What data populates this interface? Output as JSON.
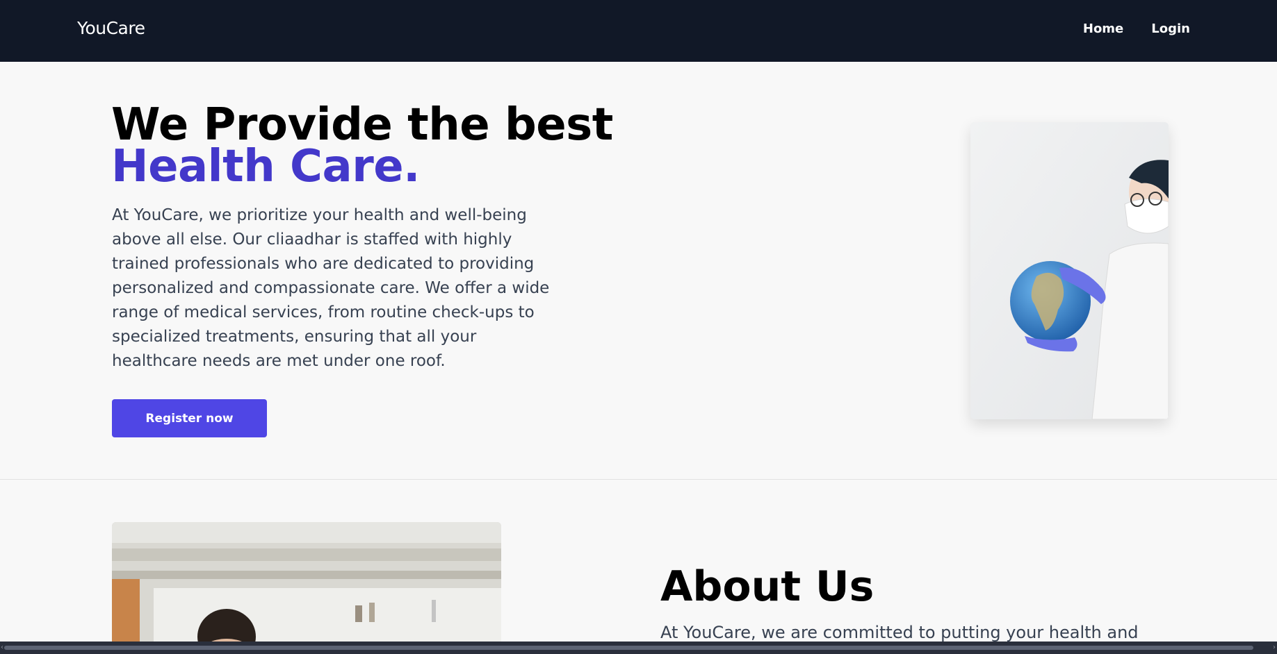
{
  "navbar": {
    "brand": "YouCare",
    "links": [
      "Home",
      "Login"
    ]
  },
  "hero": {
    "title_line1": "We Provide the best",
    "title_line2": "Health Care.",
    "description": "At YouCare, we prioritize your health and well-being above all else. Our cliaadhar is staffed with highly trained professionals who are dedicated to providing personalized and compassionate care. We offer a wide range of medical services, from routine check-ups to specialized treatments, ensuring that all your healthcare needs are met under one roof.",
    "cta_label": "Register now"
  },
  "about": {
    "title": "About Us",
    "description": "At YouCare, we are committed to putting your health and"
  },
  "colors": {
    "navbar_bg": "#111827",
    "accent": "#4338ca",
    "button": "#4f46e5",
    "page_bg": "#f8f8f8"
  }
}
